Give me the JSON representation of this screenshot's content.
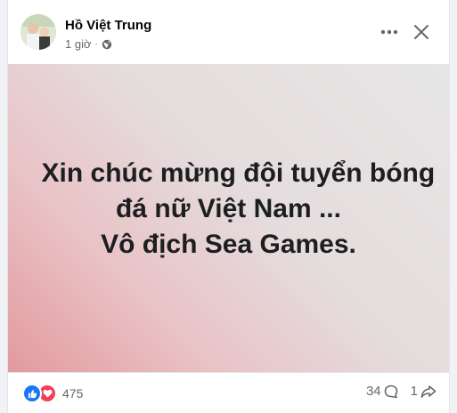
{
  "post": {
    "author": "Hồ Việt Trung",
    "time": "1 giờ",
    "separator": "·",
    "privacy_icon": "globe-icon",
    "text_lines": [
      "Xin chúc mừng đội tuyển bóng",
      "đá nữ Việt Nam ...",
      "Vô địch Sea Games."
    ],
    "background_colors": [
      "#e29a9e",
      "#e9c3c6",
      "#e6e6e6"
    ]
  },
  "header_actions": {
    "more_icon": "more-horizontal-icon",
    "close_icon": "close-icon"
  },
  "footer": {
    "reaction_icons": [
      "like-icon",
      "love-icon"
    ],
    "reaction_count": "475",
    "comment_count": "34",
    "comment_icon": "comment-icon",
    "share_count": "1",
    "share_icon": "share-icon"
  }
}
